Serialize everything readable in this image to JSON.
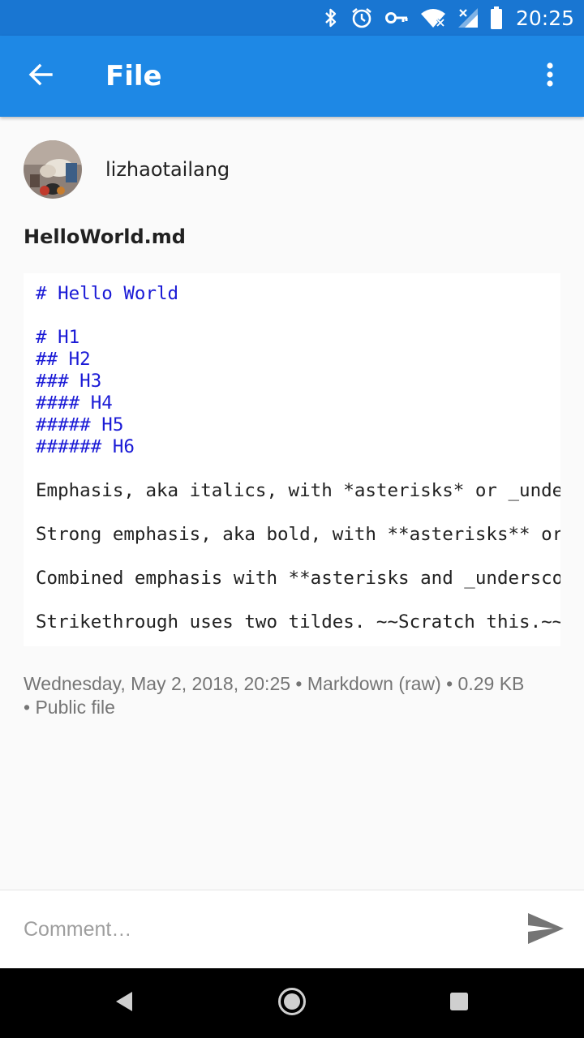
{
  "status_bar": {
    "time": "20:25",
    "icons": [
      "bluetooth-icon",
      "alarm-icon",
      "vpn-key-icon",
      "wifi-icon",
      "signal-icon",
      "battery-icon"
    ]
  },
  "app_bar": {
    "title": "File",
    "back_icon": "arrow-back-icon",
    "menu_icon": "more-vertical-icon"
  },
  "author": {
    "username": "lizhaotailang"
  },
  "file": {
    "name": "HelloWorld.md",
    "code_lines": [
      "# Hello World",
      "",
      "# H1",
      "## H2",
      "### H3",
      "#### H4",
      "##### H5",
      "###### H6",
      "",
      "Emphasis, aka italics, with *asterisks* or _underscores_.",
      "",
      "Strong emphasis, aka bold, with **asterisks** or __underscores__.",
      "",
      "Combined emphasis with **asterisks and _underscores_**.",
      "",
      "Strikethrough uses two tildes. ~~Scratch this.~~"
    ],
    "meta_line1": "Wednesday, May 2, 2018, 20:25 • Markdown (raw) • 0.29 KB",
    "meta_line2": "• Public file"
  },
  "comment": {
    "placeholder": "Comment…",
    "value": "",
    "send_icon": "send-icon"
  },
  "nav_bar": {
    "icons": [
      "nav-back-icon",
      "nav-home-icon",
      "nav-recents-icon"
    ]
  },
  "colors": {
    "app_bar": "#1e88e5",
    "status_bar": "#1976d2",
    "heading_code": "#1a1ad6",
    "background": "#fafafa"
  }
}
